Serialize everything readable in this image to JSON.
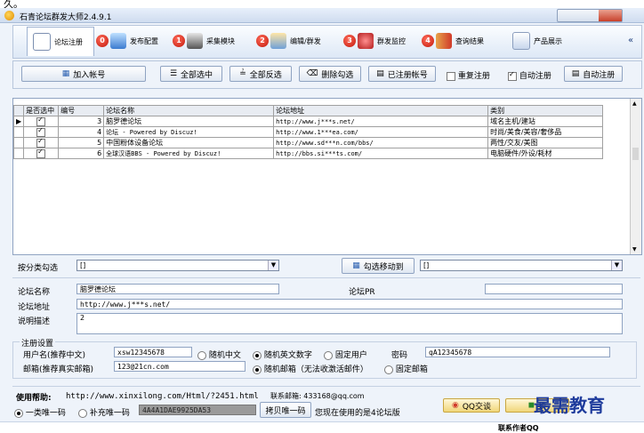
{
  "top_glyph": "久。",
  "title": "石青论坛群发大师2.4.9.1",
  "tabs": [
    {
      "label": "论坛注册",
      "badge": ""
    },
    {
      "label": "发布配置",
      "badge": "0"
    },
    {
      "label": "采集模块",
      "badge": "1"
    },
    {
      "label": "编辑/群发",
      "badge": "2"
    },
    {
      "label": "群发监控",
      "badge": "3"
    },
    {
      "label": "查询结果",
      "badge": "4"
    },
    {
      "label": "产品展示",
      "badge": ""
    }
  ],
  "toolbar": {
    "add_account": "加入帐号",
    "select_all": "全部选中",
    "invert_select": "全部反选",
    "delete_checked": "删除勾选",
    "registered_accounts": "已注册帐号",
    "re_register": "重复注册",
    "auto_register_check": "自动注册",
    "auto_register_btn": "自动注册"
  },
  "grid": {
    "headers": [
      "是否选中",
      "编号",
      "论坛名称",
      "论坛地址",
      "类别"
    ],
    "rows": [
      {
        "checked": true,
        "id": "3",
        "name": "脑罗德论坛",
        "url": "http://www.j***s.net/",
        "category": "域名主机/建站",
        "current": true
      },
      {
        "checked": true,
        "id": "4",
        "name": "论坛 -  Powered by Discuz!",
        "url": "http://www.1***ea.com/",
        "category": "时尚/美食/美容/奢侈品",
        "current": false
      },
      {
        "checked": true,
        "id": "5",
        "name": "中国粉体设备论坛",
        "url": "http://www.sd***n.com/bbs/",
        "category": "两性/交友/美图",
        "current": false
      },
      {
        "checked": true,
        "id": "6",
        "name": "全球汉语BBS  - Powered by Discuz!",
        "url": "http://bbs.si***ts.com/",
        "category": "电脑硬件/外设/耗材",
        "current": false
      }
    ]
  },
  "category_filter": {
    "label": "按分类勾选",
    "value": "[]",
    "move_btn": "勾选移动到",
    "target_value": "[]"
  },
  "details": {
    "name_label": "论坛名称",
    "name_value": "脑罗德论坛",
    "pr_label": "论坛PR",
    "pr_value": "",
    "url_label": "论坛地址",
    "url_value": "http://www.j***s.net/",
    "desc_label": "说明描述",
    "desc_value": "2"
  },
  "reg_settings": {
    "group_label": "注册设置",
    "username_label": "用户名(推荐中文)",
    "username_value": "xsw12345678",
    "opt_random_cn": "随机中文",
    "opt_random_en_num": "随机英文数字",
    "opt_fixed_user": "固定用户",
    "password_label": "密码",
    "password_value": "qA12345678",
    "email_label": "邮箱(推荐真实邮箱)",
    "email_value": "123@21cn.com",
    "opt_random_email": "随机邮箱（无法收激活邮件）",
    "opt_fixed_email": "固定邮箱"
  },
  "footer": {
    "help_label": "使用帮助:",
    "help_url": "http://www.xinxilong.com/Html/?2451.html",
    "contact": "联系邮箱: 433168@qq.com",
    "opt_one_class": "一类唯一码",
    "opt_supplement": "补充唯一码",
    "code_value": "4A4A1DAE9925DA53",
    "copy_btn": "拷贝唯一码",
    "version_note": "您现在使用的是4论坛版",
    "qq_btn": "QQ交谈",
    "second_btn": "快",
    "watermark": "最需教育",
    "bottom_text": "联系作者QQ"
  },
  "colors": {
    "accent": "#1e3b9c",
    "badge": "#c2180a",
    "panel": "#eef3fa"
  }
}
